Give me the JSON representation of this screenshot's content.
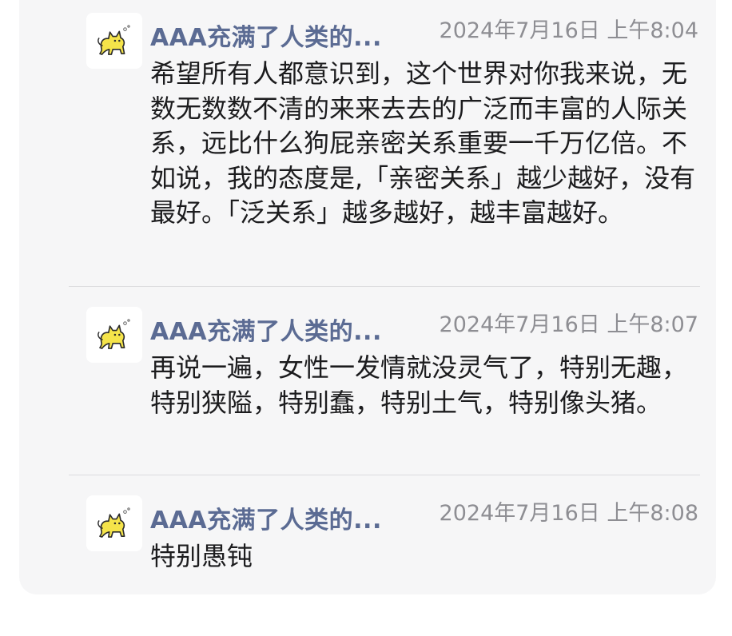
{
  "messages": [
    {
      "name": "AAA充满了人类的...",
      "time": "2024年7月16日 上午8:04",
      "text": "希望所有人都意识到，这个世界对你我来说，无数无数数不清的来来去去的广泛而丰富的人际关系，远比什么狗屁亲密关系重要一千万亿倍。不如说，我的态度是,「亲密关系」越少越好，没有最好。「泛关系」越多越好，越丰富越好。",
      "avatar_icon": "yellow-cat-icon"
    },
    {
      "name": "AAA充满了人类的...",
      "time": "2024年7月16日 上午8:07",
      "text": "再说一遍，女性一发情就没灵气了，特别无趣，特别狭隘，特别蠢，特别土气，特别像头猪。",
      "avatar_icon": "yellow-cat-icon"
    },
    {
      "name": "AAA充满了人类的...",
      "time": "2024年7月16日 上午8:08",
      "text": "特别愚钝",
      "avatar_icon": "yellow-cat-icon"
    }
  ],
  "colors": {
    "name": "#5b6b93",
    "time": "#8e8e93",
    "text": "#1c1c1e",
    "card_bg": "#f6f6f7",
    "avatar_cat": "#f5e44a"
  }
}
